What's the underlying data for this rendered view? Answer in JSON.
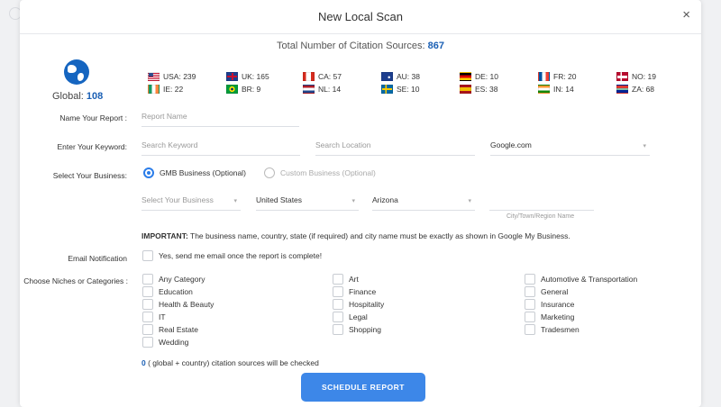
{
  "modal": {
    "title": "New Local Scan",
    "close_icon": "×"
  },
  "total": {
    "label": "Total Number of Citation Sources:",
    "value": "867"
  },
  "global": {
    "label": "Global:",
    "value": "108"
  },
  "countries": [
    {
      "code": "USA: 239",
      "flag": "us"
    },
    {
      "code": "UK: 165",
      "flag": "uk"
    },
    {
      "code": "CA: 57",
      "flag": "ca"
    },
    {
      "code": "AU: 38",
      "flag": "au"
    },
    {
      "code": "DE: 10",
      "flag": "de"
    },
    {
      "code": "FR: 20",
      "flag": "fr"
    },
    {
      "code": "NO: 19",
      "flag": "no"
    },
    {
      "code": "IE: 22",
      "flag": "ie"
    },
    {
      "code": "BR: 9",
      "flag": "br"
    },
    {
      "code": "NL: 14",
      "flag": "nl"
    },
    {
      "code": "SE: 10",
      "flag": "se"
    },
    {
      "code": "ES: 38",
      "flag": "es"
    },
    {
      "code": "IN: 14",
      "flag": "in"
    },
    {
      "code": "ZA: 68",
      "flag": "za"
    }
  ],
  "form": {
    "report_name_label": "Name Your Report :",
    "report_name_placeholder": "Report Name",
    "keyword_label": "Enter Your Keyword:",
    "keyword_placeholder": "Search Keyword",
    "location_placeholder": "Search Location",
    "engine_value": "Google.com",
    "business_label": "Select Your Business:",
    "gmb_option": "GMB Business (Optional)",
    "custom_option": "Custom Business (Optional)",
    "business_select": "Select Your Business",
    "country_select": "United States",
    "state_select": "Arizona",
    "city_caption": "City/Town/Region Name",
    "important_bold": "IMPORTANT:",
    "important_text": "The business name, country, state (if required) and city name must be exactly as shown in Google My Business.",
    "email_label": "Email Notification",
    "email_checkbox": "Yes, send me email once the report is complete!",
    "niches_label": "Choose Niches or Categories :",
    "footer_count": "0",
    "footer_text": "( global + country) citation sources will be checked",
    "submit": "SCHEDULE REPORT"
  },
  "categories": {
    "col1": [
      "Any Category",
      "Education",
      "Health & Beauty",
      "IT",
      "Real Estate",
      "Wedding"
    ],
    "col2": [
      "Art",
      "Finance",
      "Hospitality",
      "Legal",
      "Shopping"
    ],
    "col3": [
      "Automotive & Transportation",
      "General",
      "Insurance",
      "Marketing",
      "Tradesmen"
    ]
  }
}
